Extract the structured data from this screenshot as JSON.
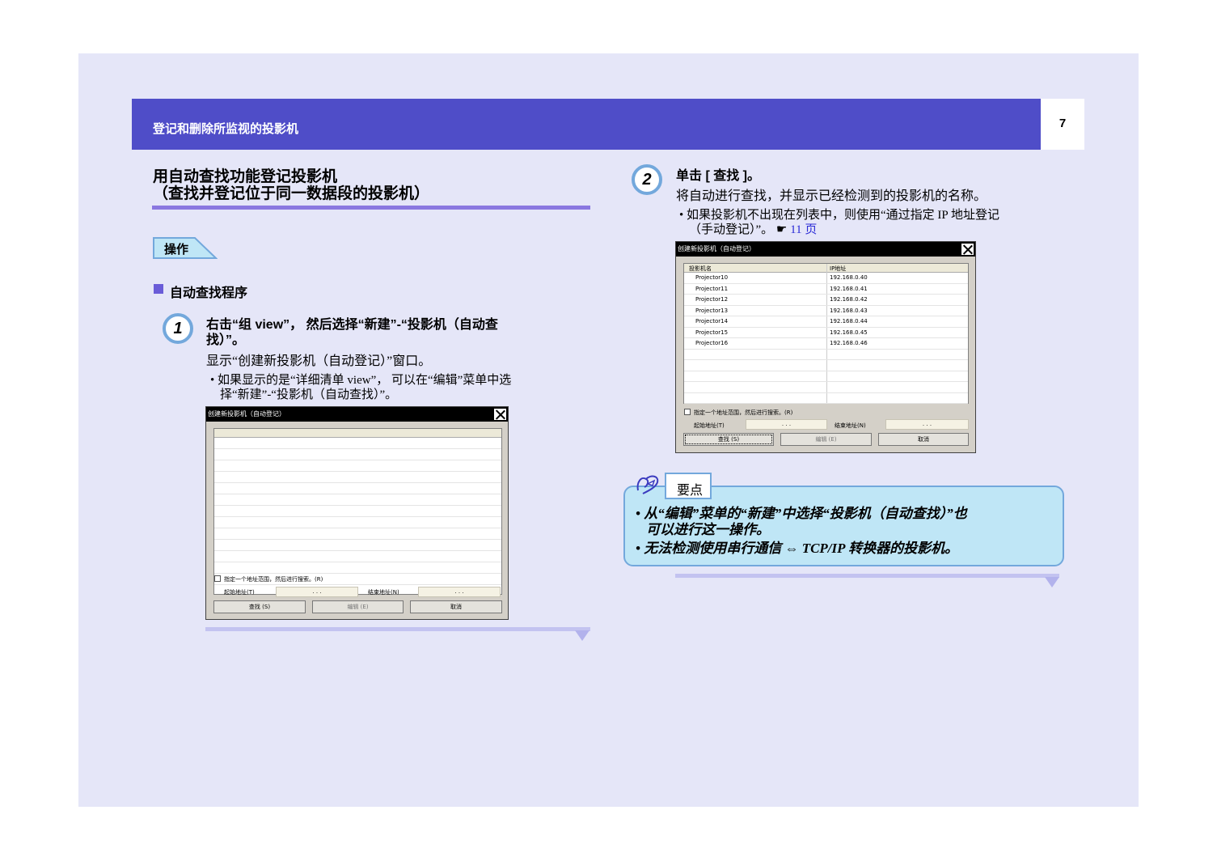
{
  "header": {
    "title": "登记和删除所监视的投影机",
    "page_number": "7"
  },
  "section": {
    "title_line1": "用自动查找功能登记投影机",
    "title_line2": "（查找并登记位于同一数据段的投影机）",
    "tag": "操作",
    "subsection": "自动查找程序"
  },
  "step1": {
    "number": "1",
    "title_line1": "右击“组 view”， 然后选择“新建”-“投影机（自动查",
    "title_line2": "找）”。",
    "body": "显示“创建新投影机（自动登记）”窗口。",
    "bullet_line1": "• 如果显示的是“详细清单 view”， 可以在“编辑”菜单中选",
    "bullet_line2": "择“新建”-“投影机（自动查找）”。"
  },
  "dialog1": {
    "title": "创建新投影机（自动登记）",
    "checkbox_label": "指定一个地址范围，然后进行搜索。(R)",
    "start_label": "起始地址(T)",
    "end_label": "结束地址(N)",
    "ip_dots": ".  .  .",
    "find_button": "查找 (S)",
    "edit_button": "编辑 (E)",
    "cancel_button": "取消"
  },
  "step2": {
    "number": "2",
    "title": "单击 [ 查找 ]。",
    "body": "将自动进行查找，并显示已经检测到的投影机的名称。",
    "bullet_line1": "• 如果投影机不出现在列表中，则使用“通过指定 IP 地址登记",
    "bullet_line2_prefix": "（手动登记）”。",
    "pointer": "☛",
    "link": "11 页"
  },
  "dialog2": {
    "title": "创建新投影机（自动登记）",
    "col_name": "投影机名",
    "col_ip": "IP地址",
    "rows": [
      {
        "name": "Projector10",
        "ip": "192.168.0.40"
      },
      {
        "name": "Projector11",
        "ip": "192.168.0.41"
      },
      {
        "name": "Projector12",
        "ip": "192.168.0.42"
      },
      {
        "name": "Projector13",
        "ip": "192.168.0.43"
      },
      {
        "name": "Projector14",
        "ip": "192.168.0.44"
      },
      {
        "name": "Projector15",
        "ip": "192.168.0.45"
      },
      {
        "name": "Projector16",
        "ip": "192.168.0.46"
      }
    ],
    "checkbox_label": "指定一个地址范围，然后进行搜索。(R)",
    "start_label": "起始地址(T)",
    "end_label": "结束地址(N)",
    "ip_dots": ".  .  .",
    "find_button": "查找 (S)",
    "edit_button": "编辑 (E)",
    "cancel_button": "取消"
  },
  "note": {
    "tab": "要点",
    "line1": "• 从“编辑”菜单的“新建”中选择“投影机（自动查找）”也",
    "line2": "可以进行这一操作。",
    "line3": "• 无法检测使用串行通信 ⇔ TCP/IP 转换器的投影机。"
  }
}
